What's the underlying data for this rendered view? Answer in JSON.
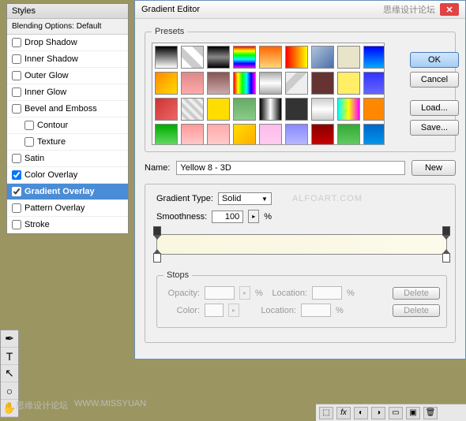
{
  "styles_panel": {
    "title": "Styles",
    "header": "Blending Options: Default",
    "items": [
      {
        "label": "Drop Shadow",
        "checked": false,
        "indent": false
      },
      {
        "label": "Inner Shadow",
        "checked": false,
        "indent": false
      },
      {
        "label": "Outer Glow",
        "checked": false,
        "indent": false
      },
      {
        "label": "Inner Glow",
        "checked": false,
        "indent": false
      },
      {
        "label": "Bevel and Emboss",
        "checked": false,
        "indent": false
      },
      {
        "label": "Contour",
        "checked": false,
        "indent": true
      },
      {
        "label": "Texture",
        "checked": false,
        "indent": true
      },
      {
        "label": "Satin",
        "checked": false,
        "indent": false
      },
      {
        "label": "Color Overlay",
        "checked": true,
        "indent": false
      },
      {
        "label": "Gradient Overlay",
        "checked": true,
        "indent": false,
        "selected": true
      },
      {
        "label": "Pattern Overlay",
        "checked": false,
        "indent": false
      },
      {
        "label": "Stroke",
        "checked": false,
        "indent": false
      }
    ]
  },
  "gradient_editor": {
    "title": "Gradient Editor",
    "header_text": "思缘设计论坛",
    "presets_label": "Presets",
    "buttons": {
      "ok": "OK",
      "cancel": "Cancel",
      "load": "Load...",
      "save": "Save...",
      "new": "New",
      "delete": "Delete"
    },
    "name_label": "Name:",
    "name_value": "Yellow 8 - 3D",
    "type_label": "Gradient Type:",
    "type_value": "Solid",
    "smooth_label": "Smoothness:",
    "smooth_value": "100",
    "pct": "%",
    "stops_label": "Stops",
    "stops": {
      "opacity_label": "Opacity:",
      "color_label": "Color:",
      "location_label": "Location:"
    }
  },
  "presets_swatches": [
    "linear-gradient(#000,#fff)",
    "linear-gradient(45deg,#fff 25%,#ccc 25%,#ccc 50%,#fff 50%,#fff 75%,#ccc 75%)",
    "linear-gradient(#000,#888,#000)",
    "linear-gradient(#f00,#ff0,#0f0,#0ff,#00f,#f0f)",
    "linear-gradient(#f60,#ffd67a)",
    "linear-gradient(to right,#f00,#ff0)",
    "linear-gradient(135deg,#b0c4de,#4a6fa5)",
    "linear-gradient(#e8e4c9,#e8e4c9)",
    "linear-gradient(#00f,#0af)",
    "linear-gradient(135deg,#f80,#fd0)",
    "linear-gradient(#d88,#faa)",
    "linear-gradient(#855,#caa)",
    "linear-gradient(to right,#f00,#ff0,#0f0,#0ff,#00f,#f0f)",
    "linear-gradient(#aaa,#fff,#aaa)",
    "linear-gradient(135deg,#eee 25%,#ccc 25%,#ccc 50%,#eee 50%)",
    "linear-gradient(#633,#633)",
    "linear-gradient(#fe6,#fe6)",
    "linear-gradient(#33f,#66f)",
    "linear-gradient(135deg,#c33,#e66)",
    "repeating-linear-gradient(45deg,#eee,#eee 4px,#ccc 4px,#ccc 8px)",
    "linear-gradient(#fd0,#fd0)",
    "linear-gradient(#6a6,#8c8)",
    "linear-gradient(to right,#000,#fff,#000)",
    "linear-gradient(#333,#333)",
    "linear-gradient(#ccc,#fff,#ccc)",
    "linear-gradient(to right,#0ff,#ff0,#f0f)",
    "linear-gradient(#f80,#f80)",
    "linear-gradient(#0a0,#6d6)",
    "linear-gradient(#f99,#fcc)",
    "linear-gradient(#faa,#fcc)",
    "linear-gradient(135deg,#fd0,#fa0)",
    "linear-gradient(#fbe,#fce)",
    "linear-gradient(#88f,#bbf)",
    "linear-gradient(#800,#c00)",
    "linear-gradient(#3a3,#6c6)",
    "linear-gradient(#06c,#09e)"
  ],
  "watermark": {
    "text1": "思缘设计论坛",
    "text2": "WWW.MISSYUAN"
  },
  "watermark_mid": "ALFOART.COM"
}
